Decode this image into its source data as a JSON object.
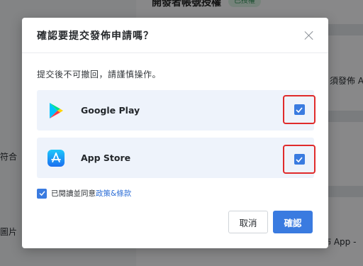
{
  "background": {
    "title": "開發者帳號授權",
    "badge": "已授權",
    "fragment_1": "須發佈 A",
    "fragment_2": "符合",
    "fragment_3": "圖片",
    "fragment_4": "佈 App -"
  },
  "dialog": {
    "title": "確認要提交發佈申請嗎？",
    "warning": "提交後不可撤回，請謹慎操作。",
    "stores": [
      {
        "name": "Google Play",
        "icon": "google-play-icon",
        "checked": true
      },
      {
        "name": "App Store",
        "icon": "app-store-icon",
        "checked": true
      }
    ],
    "agree_prefix": "已閱讀並同意",
    "agree_link": "政策&條款",
    "agree_checked": true,
    "cancel_label": "取消",
    "confirm_label": "確認"
  },
  "colors": {
    "accent": "#3a7be0",
    "highlight_border": "#e02b2b",
    "row_background": "#eef3fb"
  }
}
